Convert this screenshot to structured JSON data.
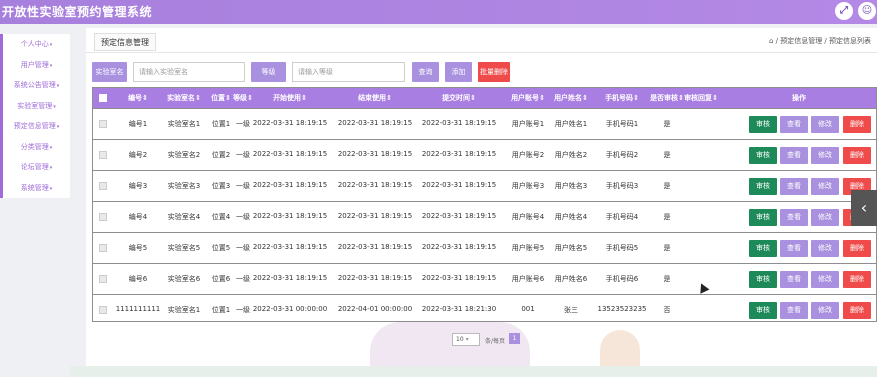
{
  "header": {
    "title": "开放性实验室预约管理系统",
    "icons": [
      "expand-icon",
      "user-icon"
    ]
  },
  "sidebar": {
    "items": [
      {
        "label": "个人中心"
      },
      {
        "label": "用户管理"
      },
      {
        "label": "系统公告管理"
      },
      {
        "label": "实验室管理"
      },
      {
        "label": "预定信息管理"
      },
      {
        "label": "分类管理"
      },
      {
        "label": "论坛管理"
      },
      {
        "label": "系统管理"
      }
    ]
  },
  "main": {
    "tab_label": "预定信息管理",
    "breadcrumb": "⌂ / 预定信息管理 / 预定信息列表"
  },
  "search": {
    "lab_name_label": "实验室名",
    "lab_name_placeholder": "请输入实验室名",
    "grade_label": "等级",
    "grade_placeholder": "请输入等级",
    "query_label": "查询",
    "add_label": "添加",
    "batch_delete_label": "批量删除"
  },
  "table": {
    "columns": [
      "编号",
      "实验室名",
      "位置",
      "等级",
      "开始使用",
      "结束使用",
      "提交时间",
      "用户账号",
      "用户姓名",
      "手机号码",
      "是否审核",
      "审核回复",
      "操作"
    ],
    "rows": [
      [
        "编号1",
        "实验室名1",
        "位置1",
        "一级",
        "2022-03-31 18:19:15",
        "2022-03-31 18:19:15",
        "2022-03-31 18:19:15",
        "用户账号1",
        "用户姓名1",
        "手机号码1",
        "是",
        ""
      ],
      [
        "编号2",
        "实验室名2",
        "位置2",
        "一级",
        "2022-03-31 18:19:15",
        "2022-03-31 18:19:15",
        "2022-03-31 18:19:15",
        "用户账号2",
        "用户姓名2",
        "手机号码2",
        "是",
        ""
      ],
      [
        "编号3",
        "实验室名3",
        "位置3",
        "一级",
        "2022-03-31 18:19:15",
        "2022-03-31 18:19:15",
        "2022-03-31 18:19:15",
        "用户账号3",
        "用户姓名3",
        "手机号码3",
        "是",
        ""
      ],
      [
        "编号4",
        "实验室名4",
        "位置4",
        "一级",
        "2022-03-31 18:19:15",
        "2022-03-31 18:19:15",
        "2022-03-31 18:19:15",
        "用户账号4",
        "用户姓名4",
        "手机号码4",
        "是",
        ""
      ],
      [
        "编号5",
        "实验室名5",
        "位置5",
        "一级",
        "2022-03-31 18:19:15",
        "2022-03-31 18:19:15",
        "2022-03-31 18:19:15",
        "用户账号5",
        "用户姓名5",
        "手机号码5",
        "是",
        ""
      ],
      [
        "编号6",
        "实验室名6",
        "位置6",
        "一级",
        "2022-03-31 18:19:15",
        "2022-03-31 18:19:15",
        "2022-03-31 18:19:15",
        "用户账号6",
        "用户姓名6",
        "手机号码6",
        "是",
        ""
      ],
      [
        "1111111111",
        "实验室名1",
        "位置1",
        "一级",
        "2022-03-31 00:00:00",
        "2022-04-01 00:00:00",
        "2022-03-31 18:21:30",
        "001",
        "张三",
        "13523523235",
        "否",
        ""
      ]
    ],
    "actions": {
      "audit": "审核",
      "view": "查看",
      "edit": "修改",
      "delete": "删除"
    }
  },
  "pager": {
    "page_size": "10",
    "page_size_text": "条/每页",
    "current_page": "1"
  },
  "colors": {
    "accent": "#a97ee3",
    "danger": "#f04b4b",
    "success": "#1e8a5a"
  }
}
